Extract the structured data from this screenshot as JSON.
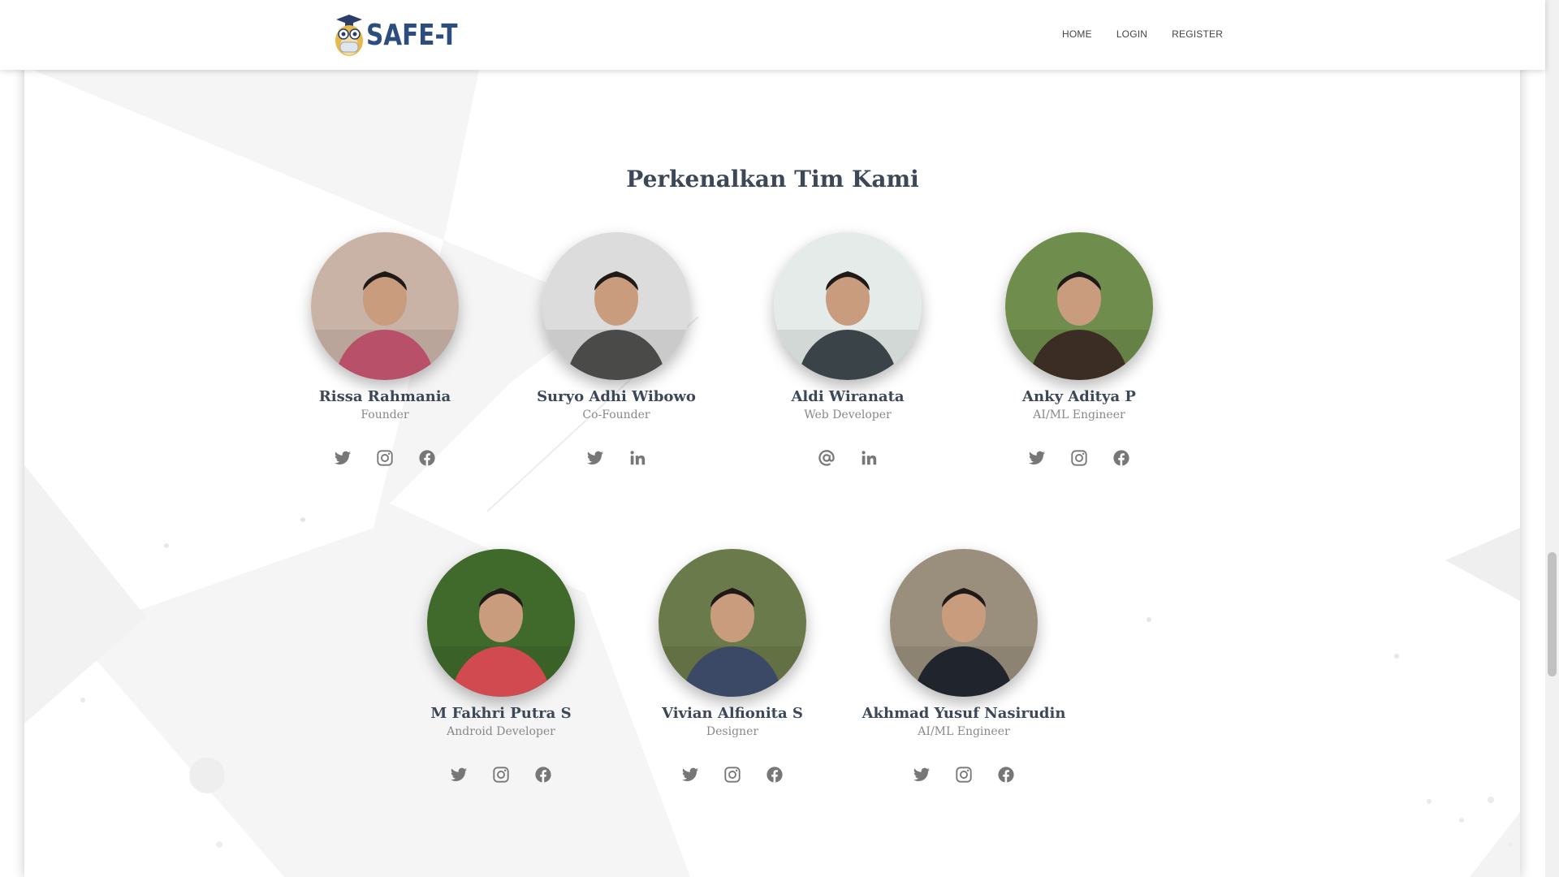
{
  "app": {
    "logo_text": "SAFE-T",
    "nav": [
      {
        "label": "HOME",
        "icon": "none"
      },
      {
        "label": "LOGIN",
        "icon": "none"
      },
      {
        "label": "REGISTER",
        "icon": "none"
      }
    ]
  },
  "section": {
    "title": "Perkenalkan Tim Kami"
  },
  "team": [
    {
      "name": "Rissa Rahmania",
      "role": "Founder",
      "socials": [
        "twitter-icon",
        "instagram-icon",
        "facebook-icon"
      ],
      "photo_bg": "#c9b3a6",
      "photo_fg": "#b8506a"
    },
    {
      "name": "Suryo Adhi Wibowo",
      "role": "Co-Founder",
      "socials": [
        "twitter-icon",
        "linkedin-icon"
      ],
      "photo_bg": "#dcdcdc",
      "photo_fg": "#4a4a48"
    },
    {
      "name": "Aldi Wiranata",
      "role": "Web Developer",
      "socials": [
        "email-at-icon",
        "linkedin-icon"
      ],
      "photo_bg": "#e4ebe8",
      "photo_fg": "#3a4448"
    },
    {
      "name": "Anky Aditya P",
      "role": "AI/ML Engineer",
      "socials": [
        "twitter-icon",
        "instagram-icon",
        "facebook-icon"
      ],
      "photo_bg": "#6f8d4c",
      "photo_fg": "#3b2c24"
    },
    {
      "name": "M Fakhri Putra S",
      "role": "Android Developer",
      "socials": [
        "twitter-icon",
        "instagram-icon",
        "facebook-icon"
      ],
      "photo_bg": "#3f6a2c",
      "photo_fg": "#d14a4f"
    },
    {
      "name": "Vivian Alfionita S",
      "role": "Designer",
      "socials": [
        "twitter-icon",
        "instagram-icon",
        "facebook-icon"
      ],
      "photo_bg": "#6b7a4a",
      "photo_fg": "#3b4866"
    },
    {
      "name": "Akhmad Yusuf Nasirudin",
      "role": "AI/ML Engineer",
      "socials": [
        "twitter-icon",
        "instagram-icon",
        "facebook-icon"
      ],
      "photo_bg": "#9a8f7c",
      "photo_fg": "#20242c"
    }
  ],
  "colors": {
    "heading": "#3c4858",
    "subtext": "#888888",
    "icon": "#777777",
    "brand": "#2b4e7e"
  }
}
